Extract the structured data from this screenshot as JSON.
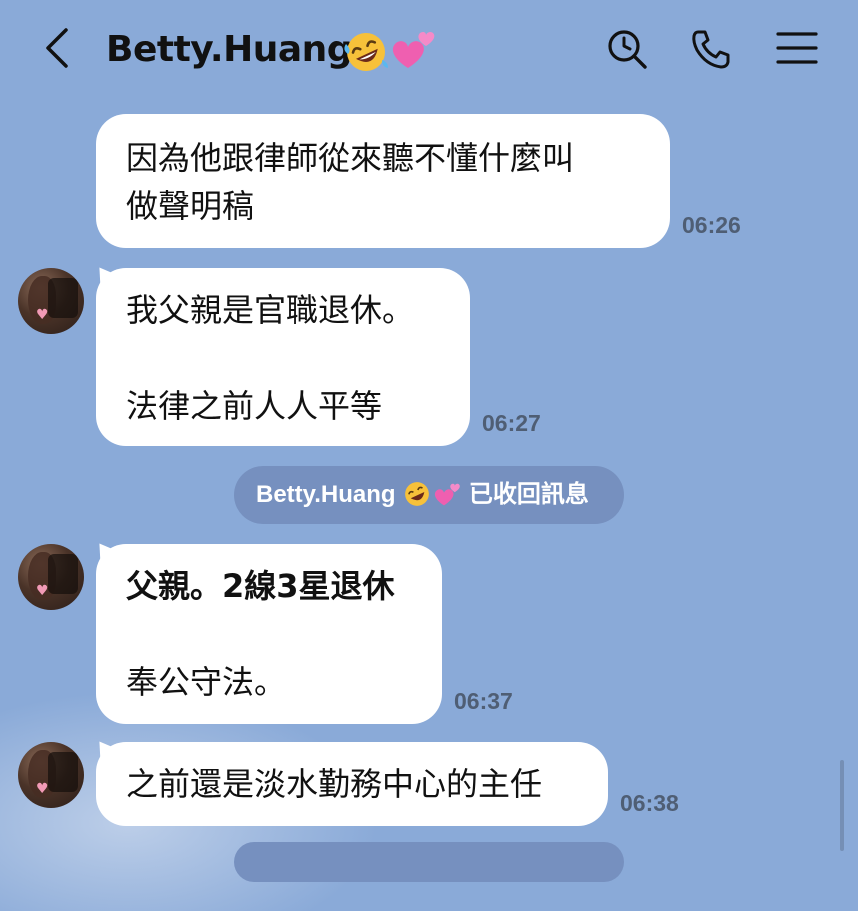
{
  "header": {
    "title": "Betty.Huang",
    "icons": [
      "chevron-left-icon",
      "rofl-emoji-icon",
      "two-hearts-emoji-icon",
      "search-icon",
      "phone-icon",
      "menu-icon"
    ]
  },
  "messages": [
    {
      "lines": [
        "因為他跟律師從來聽不懂什麼叫",
        "做聲明稿"
      ],
      "time": "06:26"
    },
    {
      "lines": [
        "我父親是官職退休。",
        "",
        "法律之前人人平等"
      ],
      "time": "06:27"
    },
    {
      "lines": [
        "父親。2線3星退休",
        "",
        "奉公守法。"
      ],
      "time": "06:37"
    },
    {
      "lines": [
        "之前還是淡水勤務中心的主任"
      ],
      "time": "06:38"
    }
  ],
  "system_notice": {
    "name": "Betty.Huang",
    "text": "已收回訊息"
  },
  "colors": {
    "background": "#8aaad8",
    "bubble": "#ffffff",
    "system_pill": "#7690bf",
    "time_text": "#4f5e74",
    "title_text": "#111111"
  }
}
